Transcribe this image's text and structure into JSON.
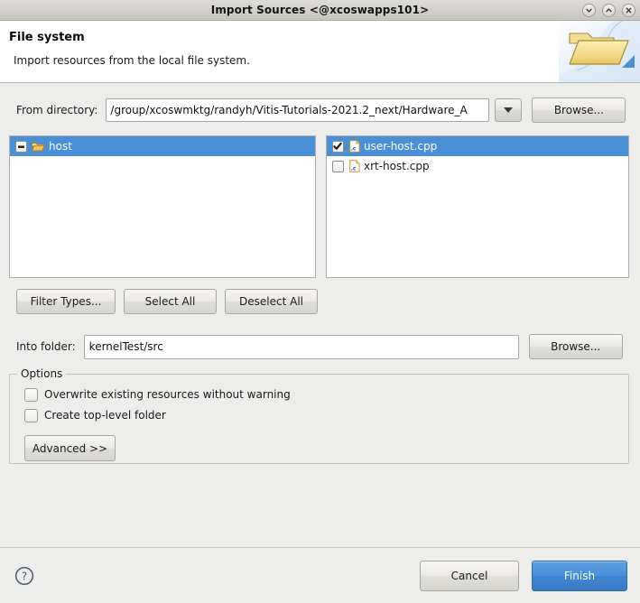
{
  "window": {
    "title": "Import Sources  <@xcoswapps101>",
    "buttons": {
      "minimize": "minimize",
      "maximize": "maximize",
      "close": "close"
    }
  },
  "banner": {
    "title": "File system",
    "subtitle": "Import resources from the local file system.",
    "icon": "open-folder-icon"
  },
  "from_directory": {
    "label": "From directory:",
    "value": "/group/xcoswmktg/randyh/Vitis-Tutorials-2021.2_next/Hardware_A",
    "placeholder": "",
    "dropdown_icon": "chevron-down-icon",
    "browse_label": "Browse..."
  },
  "tree": {
    "folders": [
      {
        "label": "host",
        "checkbox_state": "partial",
        "selected": true,
        "icon": "open-folder-icon"
      }
    ],
    "files": [
      {
        "label": "user-host.cpp",
        "checkbox_state": "checked",
        "selected": true,
        "icon": "c-file-icon"
      },
      {
        "label": "xrt-host.cpp",
        "checkbox_state": "unchecked",
        "selected": false,
        "icon": "c-file-icon"
      }
    ]
  },
  "filter_buttons": {
    "filter_types": "Filter Types...",
    "select_all": "Select All",
    "deselect_all": "Deselect All"
  },
  "into_folder": {
    "label": "Into folder:",
    "value": "kernelTest/src",
    "placeholder": "",
    "browse_label": "Browse..."
  },
  "options": {
    "title": "Options",
    "items": [
      {
        "label": "Overwrite existing resources without warning",
        "checked": false
      },
      {
        "label": "Create top-level folder",
        "checked": false
      }
    ],
    "advanced_label": "Advanced >>"
  },
  "footer": {
    "help_icon": "help-icon",
    "cancel_label": "Cancel",
    "finish_label": "Finish"
  },
  "colors": {
    "selection_blue": "#4a90d9",
    "primary_button": "#3f85ce",
    "window_bg": "#ededeb",
    "folder_icon": "#e8a33d"
  }
}
